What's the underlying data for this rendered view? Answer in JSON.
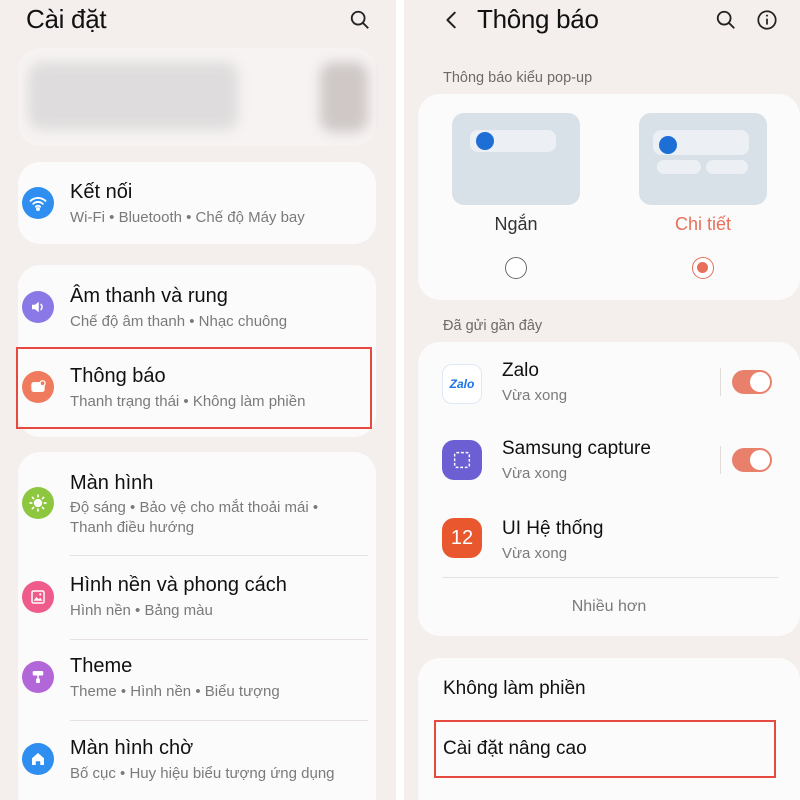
{
  "left": {
    "title": "Cài đặt",
    "groups": [
      {
        "items": [
          {
            "title": "Kết nối",
            "subtitle_lines": [
              "Wi-Fi  •  Bluetooth  •  Chế độ Máy bay"
            ],
            "icon": "wifi-icon",
            "color": "#2f8ff0"
          }
        ]
      },
      {
        "items": [
          {
            "title": "Âm thanh và rung",
            "subtitle_lines": [
              "Chế độ âm thanh  •  Nhạc chuông"
            ],
            "icon": "speaker-icon",
            "color": "#8a78e6"
          },
          {
            "title": "Thông báo",
            "subtitle_lines": [
              "Thanh trạng thái  •  Không làm phiền"
            ],
            "icon": "notification-icon",
            "color": "#f07a5e"
          }
        ]
      },
      {
        "items": [
          {
            "title": "Màn hình",
            "subtitle_lines": [
              "Độ sáng  •  Bảo vệ cho mắt thoải mái  •",
              "Thanh điều hướng"
            ],
            "icon": "brightness-icon",
            "color": "#8dc63f"
          },
          {
            "title": "Hình nền và phong cách",
            "subtitle_lines": [
              "Hình nền  •  Bảng màu"
            ],
            "icon": "wallpaper-icon",
            "color": "#ef5b8a"
          },
          {
            "title": "Theme",
            "subtitle_lines": [
              "Theme  •  Hình nền  •  Biểu tượng"
            ],
            "icon": "theme-icon",
            "color": "#b267d8"
          },
          {
            "title": "Màn hình chờ",
            "subtitle_lines": [
              "Bố cục  •  Huy hiệu biểu tượng ứng dụng"
            ],
            "icon": "home-icon",
            "color": "#2f8ff0"
          }
        ]
      }
    ]
  },
  "right": {
    "title": "Thông báo",
    "popup_section_label": "Thông báo kiểu pop-up",
    "popup_options": [
      {
        "label": "Ngắn",
        "selected": false
      },
      {
        "label": "Chi tiết",
        "selected": true
      }
    ],
    "recent_section_label": "Đã gửi gần đây",
    "apps": [
      {
        "name": "Zalo",
        "time": "Vừa xong",
        "toggle": true,
        "icon": "zalo-icon"
      },
      {
        "name": "Samsung capture",
        "time": "Vừa xong",
        "toggle": true,
        "icon": "samsung-capture-icon"
      },
      {
        "name": "UI Hệ thống",
        "time": "Vừa xong",
        "toggle": false,
        "icon": "system-ui-icon"
      }
    ],
    "more_label": "Nhiều hơn",
    "dnd_label": "Không làm phiền",
    "advanced_label": "Cài đặt nâng cao",
    "zalo_logo_text": "Zalo",
    "system_ui_logo_text": "12"
  },
  "colors": {
    "highlight": "#e6493f",
    "accent": "#e76f5b",
    "background": "#f4eeed"
  }
}
